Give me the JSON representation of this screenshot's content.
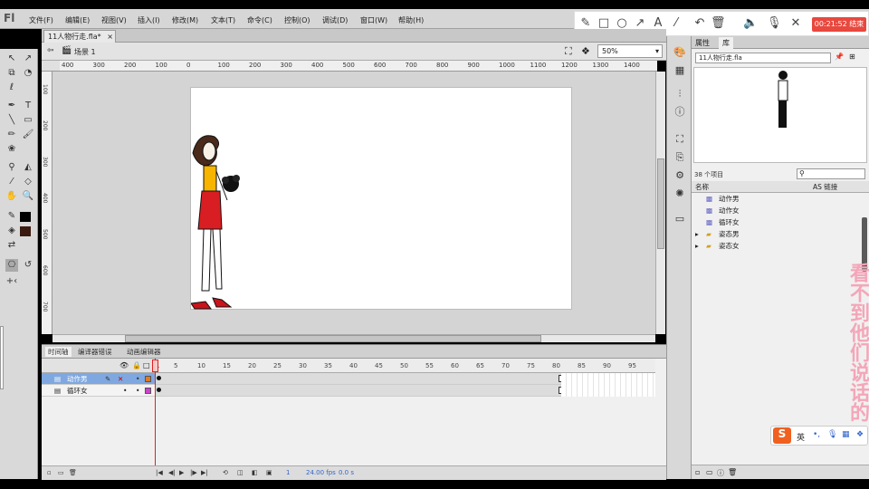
{
  "app": {
    "logo": "Fl"
  },
  "menu": [
    "文件(F)",
    "编辑(E)",
    "视图(V)",
    "插入(I)",
    "修改(M)",
    "文本(T)",
    "命令(C)",
    "控制(O)",
    "调试(D)",
    "窗口(W)",
    "帮助(H)"
  ],
  "recorder": {
    "time": "00:21:52 结束"
  },
  "document": {
    "tab": "11人物行走.fla*",
    "close": "×",
    "scene": "场景 1",
    "zoom": "50%"
  },
  "ruler": {
    "top": [
      "400",
      "300",
      "200",
      "100",
      "0",
      "100",
      "200",
      "300",
      "400",
      "500",
      "600",
      "700",
      "800",
      "900",
      "1000",
      "1100",
      "1200",
      "1300",
      "1400"
    ],
    "left": [
      "100",
      "200",
      "300",
      "400",
      "500",
      "600",
      "700"
    ]
  },
  "timeline": {
    "tabs": [
      "时间轴",
      "编译器错误",
      "动画编辑器"
    ],
    "frame_numbers": [
      "1",
      "5",
      "10",
      "15",
      "20",
      "25",
      "30",
      "35",
      "40",
      "45",
      "50",
      "55",
      "60",
      "65",
      "70",
      "75",
      "80",
      "85",
      "90",
      "95"
    ],
    "layers": [
      {
        "name": "动作男",
        "color": "#e07a20",
        "selected": true
      },
      {
        "name": "循环女",
        "color": "#d040d0",
        "selected": false
      }
    ],
    "status": {
      "frame": "1",
      "fps": "24.00 fps",
      "time": "0.0 s"
    }
  },
  "library": {
    "tabs": [
      "属性",
      "库"
    ],
    "file": "11人物行走.fla",
    "count": "38 个项目",
    "col_name": "名称",
    "col_link": "AS 链接",
    "items": [
      {
        "name": "动作男",
        "type": "symbol"
      },
      {
        "name": "动作女",
        "type": "symbol"
      },
      {
        "name": "循环女",
        "type": "symbol"
      },
      {
        "name": "姿态男",
        "type": "folder"
      },
      {
        "name": "姿态女",
        "type": "folder"
      }
    ]
  },
  "overlay": {
    "text": "看不到他们说话的"
  },
  "ime": {
    "label": "英"
  }
}
